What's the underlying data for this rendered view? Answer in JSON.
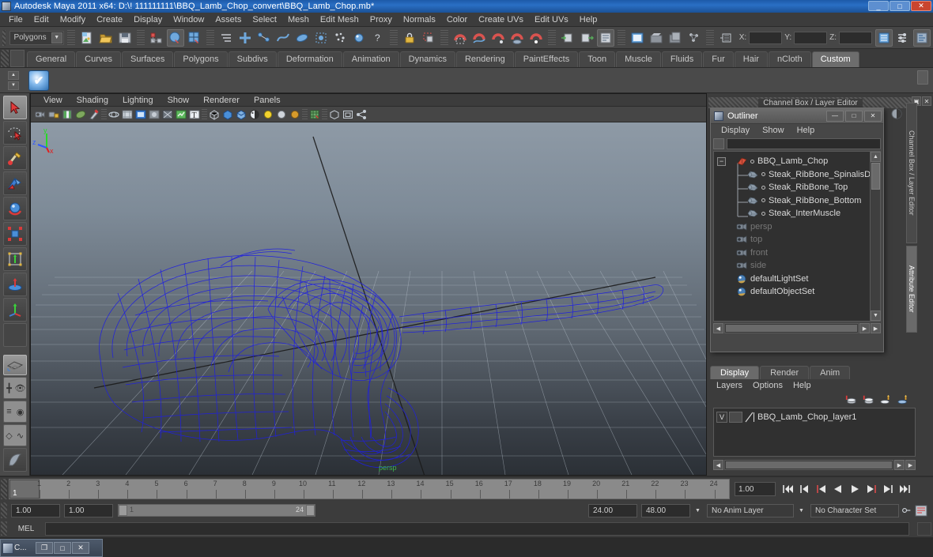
{
  "window": {
    "title": "Autodesk Maya 2011 x64: D:\\! 111111111\\BBQ_Lamb_Chop_convert\\BBQ_Lamb_Chop.mb*",
    "minimize": "_",
    "maximize": "□",
    "close": "✕"
  },
  "menubar": {
    "items": [
      "File",
      "Edit",
      "Modify",
      "Create",
      "Display",
      "Window",
      "Assets",
      "Select",
      "Mesh",
      "Edit Mesh",
      "Proxy",
      "Normals",
      "Color",
      "Create UVs",
      "Edit UVs",
      "Help"
    ]
  },
  "statusbar": {
    "menu_set": "Polygons",
    "coord_labels": {
      "x": "X:",
      "y": "Y:",
      "z": "Z:"
    },
    "coord_values": {
      "x": "",
      "y": "",
      "z": ""
    },
    "icons": [
      "new-scene-icon",
      "open-scene-icon",
      "save-scene-icon",
      "select-by-hierarchy-icon",
      "select-by-object-icon",
      "select-by-component-icon",
      "select-mask-icon",
      "select-handles-icon",
      "select-joints-icon",
      "select-curves-icon",
      "select-surfaces-icon",
      "select-deformations-icon",
      "select-dynamics-icon",
      "select-rendering-icon",
      "select-misc-icon",
      "lock-icon",
      "highlight-selection-icon",
      "snap-grid-icon",
      "snap-curve-icon",
      "snap-point-icon",
      "snap-view-plane-icon",
      "snap-normal-icon",
      "construction-history-input-icon",
      "construction-history-output-icon",
      "construction-history-icon",
      "render-current-frame-icon",
      "ipr-render-icon",
      "render-settings-icon",
      "open-hypershade-icon",
      "select-set-icon",
      "show-channel-box-icon",
      "show-attribute-editor-icon",
      "show-tool-settings-icon"
    ]
  },
  "shelf": {
    "tabs": [
      "General",
      "Curves",
      "Surfaces",
      "Polygons",
      "Subdivs",
      "Deformation",
      "Animation",
      "Dynamics",
      "Rendering",
      "PaintEffects",
      "Toon",
      "Muscle",
      "Fluids",
      "Fur",
      "Hair",
      "nCloth",
      "Custom"
    ],
    "active_tab": "Custom",
    "items": [
      {
        "name": "custom-check-tool",
        "glyph": "✔"
      }
    ],
    "trash_icon": "trash-icon"
  },
  "toolbox": {
    "tools": [
      {
        "name": "select-tool",
        "selected": true
      },
      {
        "name": "lasso-select-tool",
        "selected": false
      },
      {
        "name": "paint-select-tool",
        "selected": false
      },
      {
        "name": "move-tool",
        "selected": false
      },
      {
        "name": "rotate-tool",
        "selected": false
      },
      {
        "name": "scale-tool",
        "selected": false
      },
      {
        "name": "universal-manipulator-tool",
        "selected": false
      },
      {
        "name": "soft-modification-tool",
        "selected": false
      },
      {
        "name": "last-tool-used",
        "selected": false
      },
      {
        "name": "blank-slot",
        "selected": false
      }
    ],
    "layouts": [
      {
        "name": "single-perspective-layout"
      },
      {
        "name": "four-view-layout"
      },
      {
        "name": "outliner-persp-layout"
      },
      {
        "name": "hypergraph-persp-layout"
      },
      {
        "name": "saved-layouts-icon"
      }
    ]
  },
  "viewport": {
    "menus": [
      "View",
      "Shading",
      "Lighting",
      "Show",
      "Renderer",
      "Panels"
    ],
    "camera_label": "persp",
    "axis": {
      "x": "x",
      "y": "y",
      "z": "z"
    },
    "toolbar_icons": [
      "select-camera-icon",
      "lock-camera-icon",
      "image-plane-icon",
      "two-d-pan-zoom-icon",
      "grease-pencil-icon",
      "wireframe-icon",
      "smooth-shade-icon",
      "smooth-shade-all-icon",
      "hardware-texturing-icon",
      "use-all-lights-icon",
      "shadows-icon",
      "xray-icon",
      "isolate-select-icon",
      "xray-joints-icon",
      "smooth-preview-icon",
      "hardware-fog-icon",
      "light-one-icon",
      "light-two-icon",
      "light-three-icon",
      "grid-icon",
      "single-view-icon",
      "multi-view-icon",
      "share-view-icon"
    ]
  },
  "right_dock": {
    "header": "Channel Box / Layer Editor",
    "header_buttons": [
      "▣",
      "✕"
    ],
    "vertical_tabs": [
      {
        "label": "Channel Box / Layer Editor",
        "active": false
      },
      {
        "label": "Attribute Editor",
        "active": true
      }
    ],
    "side_icons": [
      "half-circle-icon",
      "pencil-icon"
    ]
  },
  "outliner": {
    "title": "Outliner",
    "window_buttons": {
      "minimize": "—",
      "maximize": "□",
      "close": "✕"
    },
    "menus": [
      "Display",
      "Show",
      "Help"
    ],
    "search_value": "",
    "tree": [
      {
        "label": "BBQ_Lamb_Chop",
        "depth": 0,
        "icon": "transform-icon",
        "expandable": true,
        "dimmed": false,
        "dot": true
      },
      {
        "label": "Steak_RibBone_SpinalisDorsi",
        "depth": 1,
        "icon": "mesh-icon",
        "expandable": false,
        "dimmed": false,
        "dot": true
      },
      {
        "label": "Steak_RibBone_Top",
        "depth": 1,
        "icon": "mesh-icon",
        "expandable": false,
        "dimmed": false,
        "dot": true
      },
      {
        "label": "Steak_RibBone_Bottom",
        "depth": 1,
        "icon": "mesh-icon",
        "expandable": false,
        "dimmed": false,
        "dot": true
      },
      {
        "label": "Steak_InterMuscle",
        "depth": 1,
        "icon": "mesh-icon",
        "expandable": false,
        "dimmed": false,
        "dot": true
      },
      {
        "label": "persp",
        "depth": 0,
        "icon": "camera-icon",
        "expandable": false,
        "dimmed": true,
        "dot": false
      },
      {
        "label": "top",
        "depth": 0,
        "icon": "camera-icon",
        "expandable": false,
        "dimmed": true,
        "dot": false
      },
      {
        "label": "front",
        "depth": 0,
        "icon": "camera-icon",
        "expandable": false,
        "dimmed": true,
        "dot": false
      },
      {
        "label": "side",
        "depth": 0,
        "icon": "camera-icon",
        "expandable": false,
        "dimmed": true,
        "dot": false
      },
      {
        "label": "defaultLightSet",
        "depth": 0,
        "icon": "set-icon",
        "expandable": false,
        "dimmed": false,
        "dot": false
      },
      {
        "label": "defaultObjectSet",
        "depth": 0,
        "icon": "set-icon",
        "expandable": false,
        "dimmed": false,
        "dot": false
      }
    ]
  },
  "layer_editor": {
    "tabs": [
      "Display",
      "Render",
      "Anim"
    ],
    "active_tab": "Display",
    "menus": [
      "Layers",
      "Options",
      "Help"
    ],
    "toolbar_icons": [
      "new-layer-icon",
      "new-layer-from-selected-icon",
      "move-layer-up-icon",
      "move-layer-down-icon"
    ],
    "layers": [
      {
        "visibility": "V",
        "type": "",
        "name": "BBQ_Lamb_Chop_layer1"
      }
    ]
  },
  "timeline": {
    "start_tick": 1,
    "end_tick": 24,
    "ticks": [
      "1",
      "2",
      "3",
      "4",
      "5",
      "6",
      "7",
      "8",
      "9",
      "10",
      "11",
      "12",
      "13",
      "14",
      "15",
      "16",
      "17",
      "18",
      "19",
      "20",
      "21",
      "22",
      "23",
      "24"
    ],
    "current_frame_label": "1",
    "current_time_field": "1.00",
    "playback_buttons": [
      "go-to-start-icon",
      "step-back-keyframe-icon",
      "step-back-frame-icon",
      "play-backwards-icon",
      "play-forwards-icon",
      "step-forward-frame-icon",
      "step-forward-keyframe-icon",
      "go-to-end-icon"
    ]
  },
  "range_slider": {
    "anim_start": "1.00",
    "range_start": "1.00",
    "range_bar_start": "1",
    "range_bar_end": "24",
    "range_end": "24.00",
    "anim_end": "48.00",
    "anim_layer": "No Anim Layer",
    "character_set": "No Character Set",
    "auto_key_icon": "auto-keyframe-icon",
    "animation_prefs_icon": "animation-preferences-icon"
  },
  "mel": {
    "label": "MEL",
    "command_value": "",
    "placeholder": ""
  },
  "taskbar": {
    "label": "C...",
    "buttons": [
      "❐",
      "□",
      "✕"
    ]
  }
}
